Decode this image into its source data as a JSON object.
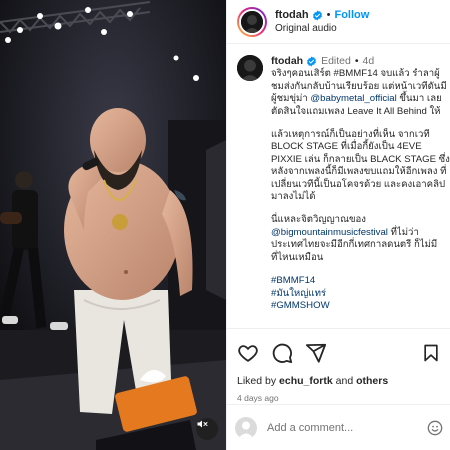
{
  "post": {
    "username": "ftodah",
    "follow_label": "Follow",
    "audio_label": "Original audio",
    "edited_label": "Edited",
    "time_short": "4d",
    "caption": {
      "p1": "จริงๆคอนเสิร์ต #BMMF14 จบแล้ว รําลาผู้ชมส่งกันกลับบ้านเรียบร้อย แต่หน้าเวทีดันมีผู้ชมขุ่ม่า ",
      "p1_mention": "@babymetal_official",
      "p1_tail": " ขึ้นมา เลยตัดสินใจแถมเพลง Leave It All Behind ให้",
      "p2": "แล้วเหตุการณ์ก็เป็นอย่างที่เห็น จากเวที BLOCK STAGE ที่เมื่อกี้ยังเป็น 4EVE PIXXIE เล่น ก็กลายเป็น BLACK STAGE ซึ่งหลังจากเพลงนี้ก็มีเพลงขบแถมให้อีกเพลง ที่เปลี่ยนเวทีนี้เป็นอโคจรด้วย และคงเอาคลิปมาลงไม่ได้",
      "p3": "นี่แหละจิตวิญญาณของ",
      "p3_mention": "@bigmountainmusicfestival",
      "p3_tail": " ที่ไม่ว่าประเทศไทยจะมีอีกกี่เทศกาลดนตรี ก็ไม่มีที่ไหนเหมือน",
      "hashtags": [
        "#BMMF14",
        "#มันใหญ่แทร่",
        "#GMMSHOW"
      ]
    },
    "likes": {
      "prefix": "Liked by ",
      "user": "echu_fortk",
      "mid": " and ",
      "others": "others"
    },
    "time_ago": "4 days ago",
    "comment_placeholder": "Add a comment..."
  },
  "colors": {
    "accent": "#0095f6",
    "link": "#00376b",
    "muted": "#737373",
    "border": "#efefef"
  },
  "icons": [
    "verified-badge-icon",
    "heart-icon",
    "comment-icon",
    "share-icon",
    "bookmark-icon",
    "mute-icon",
    "emoji-icon"
  ]
}
